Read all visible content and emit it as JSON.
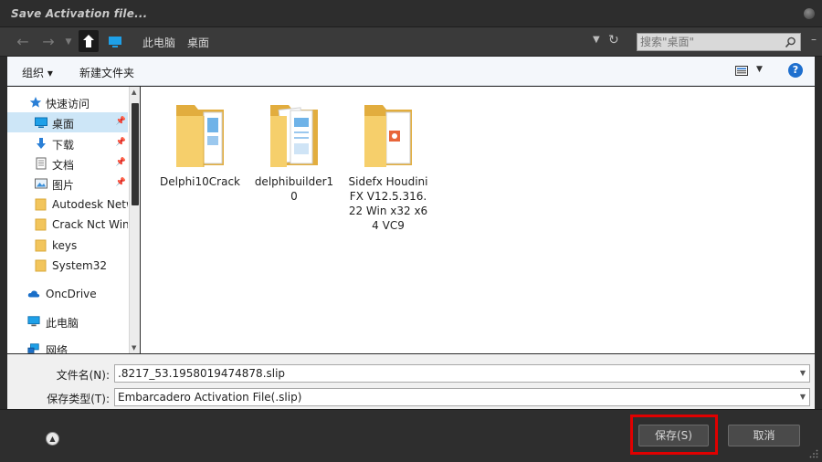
{
  "window": {
    "title": "Save Activation file..."
  },
  "nav": {
    "back": "←",
    "forward": "→",
    "breadcrumb": [
      "此电脑",
      "桌面"
    ],
    "dropdown": "▼",
    "refresh": "↻",
    "search_placeholder": "搜索\"桌面\"",
    "minimize": "–"
  },
  "toolbar": {
    "organize": "组织 ▾",
    "new_folder": "新建文件夹",
    "view_dropdown": "▼",
    "help": "?"
  },
  "sidebar": {
    "items": [
      {
        "label": "快速访问",
        "icon": "star-icon"
      },
      {
        "label": "桌面",
        "icon": "desktop-icon",
        "pinned": true,
        "selected": true
      },
      {
        "label": "下载",
        "icon": "download-icon",
        "pinned": true
      },
      {
        "label": "文档",
        "icon": "document-icon",
        "pinned": true
      },
      {
        "label": "图片",
        "icon": "pictures-icon",
        "pinned": true
      },
      {
        "label": "Autodesk Netw",
        "icon": "folder-icon"
      },
      {
        "label": "Crack Nct Win",
        "icon": "folder-icon"
      },
      {
        "label": "keys",
        "icon": "folder-icon"
      },
      {
        "label": "System32",
        "icon": "folder-icon"
      },
      {
        "label": "OncDrive",
        "icon": "cloud-icon"
      },
      {
        "label": "此电脑",
        "icon": "computer-icon"
      },
      {
        "label": "网络",
        "icon": "network-icon"
      }
    ],
    "pin_glyph": "📌"
  },
  "files": [
    {
      "name": "Delphi10Crack",
      "kind": "folder-plain"
    },
    {
      "name": "delphibuilder10",
      "kind": "folder-docs"
    },
    {
      "name": "Sidefx Houdini FX V12.5.316.22 Win x32 x64 VC9",
      "kind": "folder-media"
    }
  ],
  "fields": {
    "filename_label": "文件名(N):",
    "filename_value": ".8217_53.1958019474878.slip",
    "type_label": "保存类型(T):",
    "type_value": "Embarcadero Activation File(.slip)"
  },
  "footer": {
    "collapse_glyph": "▲",
    "save_label": "保存(S)",
    "cancel_label": "取消"
  },
  "colors": {
    "accent": "#1e6fce",
    "highlight_box": "#e00000",
    "folder": "#f2c55c"
  }
}
